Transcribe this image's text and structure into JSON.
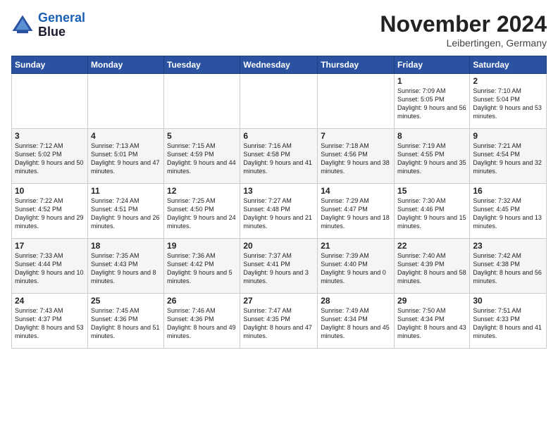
{
  "header": {
    "logo_line1": "General",
    "logo_line2": "Blue",
    "month_title": "November 2024",
    "location": "Leibertingen, Germany"
  },
  "weekdays": [
    "Sunday",
    "Monday",
    "Tuesday",
    "Wednesday",
    "Thursday",
    "Friday",
    "Saturday"
  ],
  "weeks": [
    [
      {
        "day": "",
        "sunrise": "",
        "sunset": "",
        "daylight": ""
      },
      {
        "day": "",
        "sunrise": "",
        "sunset": "",
        "daylight": ""
      },
      {
        "day": "",
        "sunrise": "",
        "sunset": "",
        "daylight": ""
      },
      {
        "day": "",
        "sunrise": "",
        "sunset": "",
        "daylight": ""
      },
      {
        "day": "",
        "sunrise": "",
        "sunset": "",
        "daylight": ""
      },
      {
        "day": "1",
        "sunrise": "Sunrise: 7:09 AM",
        "sunset": "Sunset: 5:05 PM",
        "daylight": "Daylight: 9 hours and 56 minutes."
      },
      {
        "day": "2",
        "sunrise": "Sunrise: 7:10 AM",
        "sunset": "Sunset: 5:04 PM",
        "daylight": "Daylight: 9 hours and 53 minutes."
      }
    ],
    [
      {
        "day": "3",
        "sunrise": "Sunrise: 7:12 AM",
        "sunset": "Sunset: 5:02 PM",
        "daylight": "Daylight: 9 hours and 50 minutes."
      },
      {
        "day": "4",
        "sunrise": "Sunrise: 7:13 AM",
        "sunset": "Sunset: 5:01 PM",
        "daylight": "Daylight: 9 hours and 47 minutes."
      },
      {
        "day": "5",
        "sunrise": "Sunrise: 7:15 AM",
        "sunset": "Sunset: 4:59 PM",
        "daylight": "Daylight: 9 hours and 44 minutes."
      },
      {
        "day": "6",
        "sunrise": "Sunrise: 7:16 AM",
        "sunset": "Sunset: 4:58 PM",
        "daylight": "Daylight: 9 hours and 41 minutes."
      },
      {
        "day": "7",
        "sunrise": "Sunrise: 7:18 AM",
        "sunset": "Sunset: 4:56 PM",
        "daylight": "Daylight: 9 hours and 38 minutes."
      },
      {
        "day": "8",
        "sunrise": "Sunrise: 7:19 AM",
        "sunset": "Sunset: 4:55 PM",
        "daylight": "Daylight: 9 hours and 35 minutes."
      },
      {
        "day": "9",
        "sunrise": "Sunrise: 7:21 AM",
        "sunset": "Sunset: 4:54 PM",
        "daylight": "Daylight: 9 hours and 32 minutes."
      }
    ],
    [
      {
        "day": "10",
        "sunrise": "Sunrise: 7:22 AM",
        "sunset": "Sunset: 4:52 PM",
        "daylight": "Daylight: 9 hours and 29 minutes."
      },
      {
        "day": "11",
        "sunrise": "Sunrise: 7:24 AM",
        "sunset": "Sunset: 4:51 PM",
        "daylight": "Daylight: 9 hours and 26 minutes."
      },
      {
        "day": "12",
        "sunrise": "Sunrise: 7:25 AM",
        "sunset": "Sunset: 4:50 PM",
        "daylight": "Daylight: 9 hours and 24 minutes."
      },
      {
        "day": "13",
        "sunrise": "Sunrise: 7:27 AM",
        "sunset": "Sunset: 4:48 PM",
        "daylight": "Daylight: 9 hours and 21 minutes."
      },
      {
        "day": "14",
        "sunrise": "Sunrise: 7:29 AM",
        "sunset": "Sunset: 4:47 PM",
        "daylight": "Daylight: 9 hours and 18 minutes."
      },
      {
        "day": "15",
        "sunrise": "Sunrise: 7:30 AM",
        "sunset": "Sunset: 4:46 PM",
        "daylight": "Daylight: 9 hours and 15 minutes."
      },
      {
        "day": "16",
        "sunrise": "Sunrise: 7:32 AM",
        "sunset": "Sunset: 4:45 PM",
        "daylight": "Daylight: 9 hours and 13 minutes."
      }
    ],
    [
      {
        "day": "17",
        "sunrise": "Sunrise: 7:33 AM",
        "sunset": "Sunset: 4:44 PM",
        "daylight": "Daylight: 9 hours and 10 minutes."
      },
      {
        "day": "18",
        "sunrise": "Sunrise: 7:35 AM",
        "sunset": "Sunset: 4:43 PM",
        "daylight": "Daylight: 9 hours and 8 minutes."
      },
      {
        "day": "19",
        "sunrise": "Sunrise: 7:36 AM",
        "sunset": "Sunset: 4:42 PM",
        "daylight": "Daylight: 9 hours and 5 minutes."
      },
      {
        "day": "20",
        "sunrise": "Sunrise: 7:37 AM",
        "sunset": "Sunset: 4:41 PM",
        "daylight": "Daylight: 9 hours and 3 minutes."
      },
      {
        "day": "21",
        "sunrise": "Sunrise: 7:39 AM",
        "sunset": "Sunset: 4:40 PM",
        "daylight": "Daylight: 9 hours and 0 minutes."
      },
      {
        "day": "22",
        "sunrise": "Sunrise: 7:40 AM",
        "sunset": "Sunset: 4:39 PM",
        "daylight": "Daylight: 8 hours and 58 minutes."
      },
      {
        "day": "23",
        "sunrise": "Sunrise: 7:42 AM",
        "sunset": "Sunset: 4:38 PM",
        "daylight": "Daylight: 8 hours and 56 minutes."
      }
    ],
    [
      {
        "day": "24",
        "sunrise": "Sunrise: 7:43 AM",
        "sunset": "Sunset: 4:37 PM",
        "daylight": "Daylight: 8 hours and 53 minutes."
      },
      {
        "day": "25",
        "sunrise": "Sunrise: 7:45 AM",
        "sunset": "Sunset: 4:36 PM",
        "daylight": "Daylight: 8 hours and 51 minutes."
      },
      {
        "day": "26",
        "sunrise": "Sunrise: 7:46 AM",
        "sunset": "Sunset: 4:36 PM",
        "daylight": "Daylight: 8 hours and 49 minutes."
      },
      {
        "day": "27",
        "sunrise": "Sunrise: 7:47 AM",
        "sunset": "Sunset: 4:35 PM",
        "daylight": "Daylight: 8 hours and 47 minutes."
      },
      {
        "day": "28",
        "sunrise": "Sunrise: 7:49 AM",
        "sunset": "Sunset: 4:34 PM",
        "daylight": "Daylight: 8 hours and 45 minutes."
      },
      {
        "day": "29",
        "sunrise": "Sunrise: 7:50 AM",
        "sunset": "Sunset: 4:34 PM",
        "daylight": "Daylight: 8 hours and 43 minutes."
      },
      {
        "day": "30",
        "sunrise": "Sunrise: 7:51 AM",
        "sunset": "Sunset: 4:33 PM",
        "daylight": "Daylight: 8 hours and 41 minutes."
      }
    ]
  ]
}
